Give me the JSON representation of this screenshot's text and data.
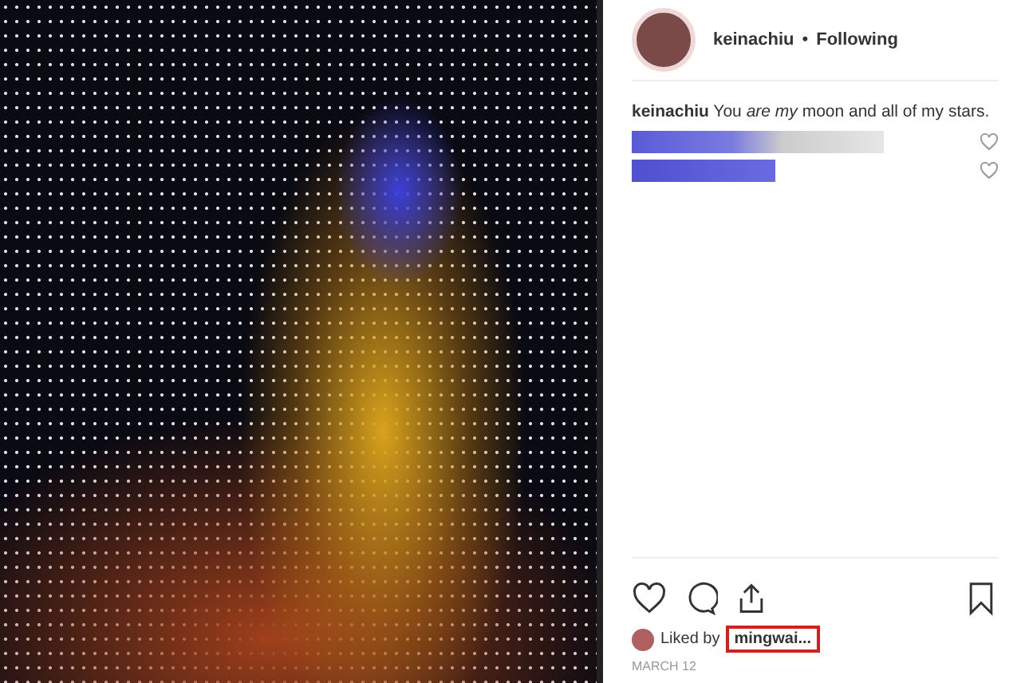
{
  "post": {
    "username": "keinachiu",
    "separator": "•",
    "follow_label": "Following"
  },
  "caption": {
    "username": "keinachiu",
    "text": "You *are my* moon and all of my stars."
  },
  "comments": [
    {
      "kind": "redacted"
    },
    {
      "kind": "redacted"
    }
  ],
  "likes": {
    "prefix": "Liked by",
    "user": "mingwai...",
    "highlighted": true
  },
  "date": "MARCH 12"
}
